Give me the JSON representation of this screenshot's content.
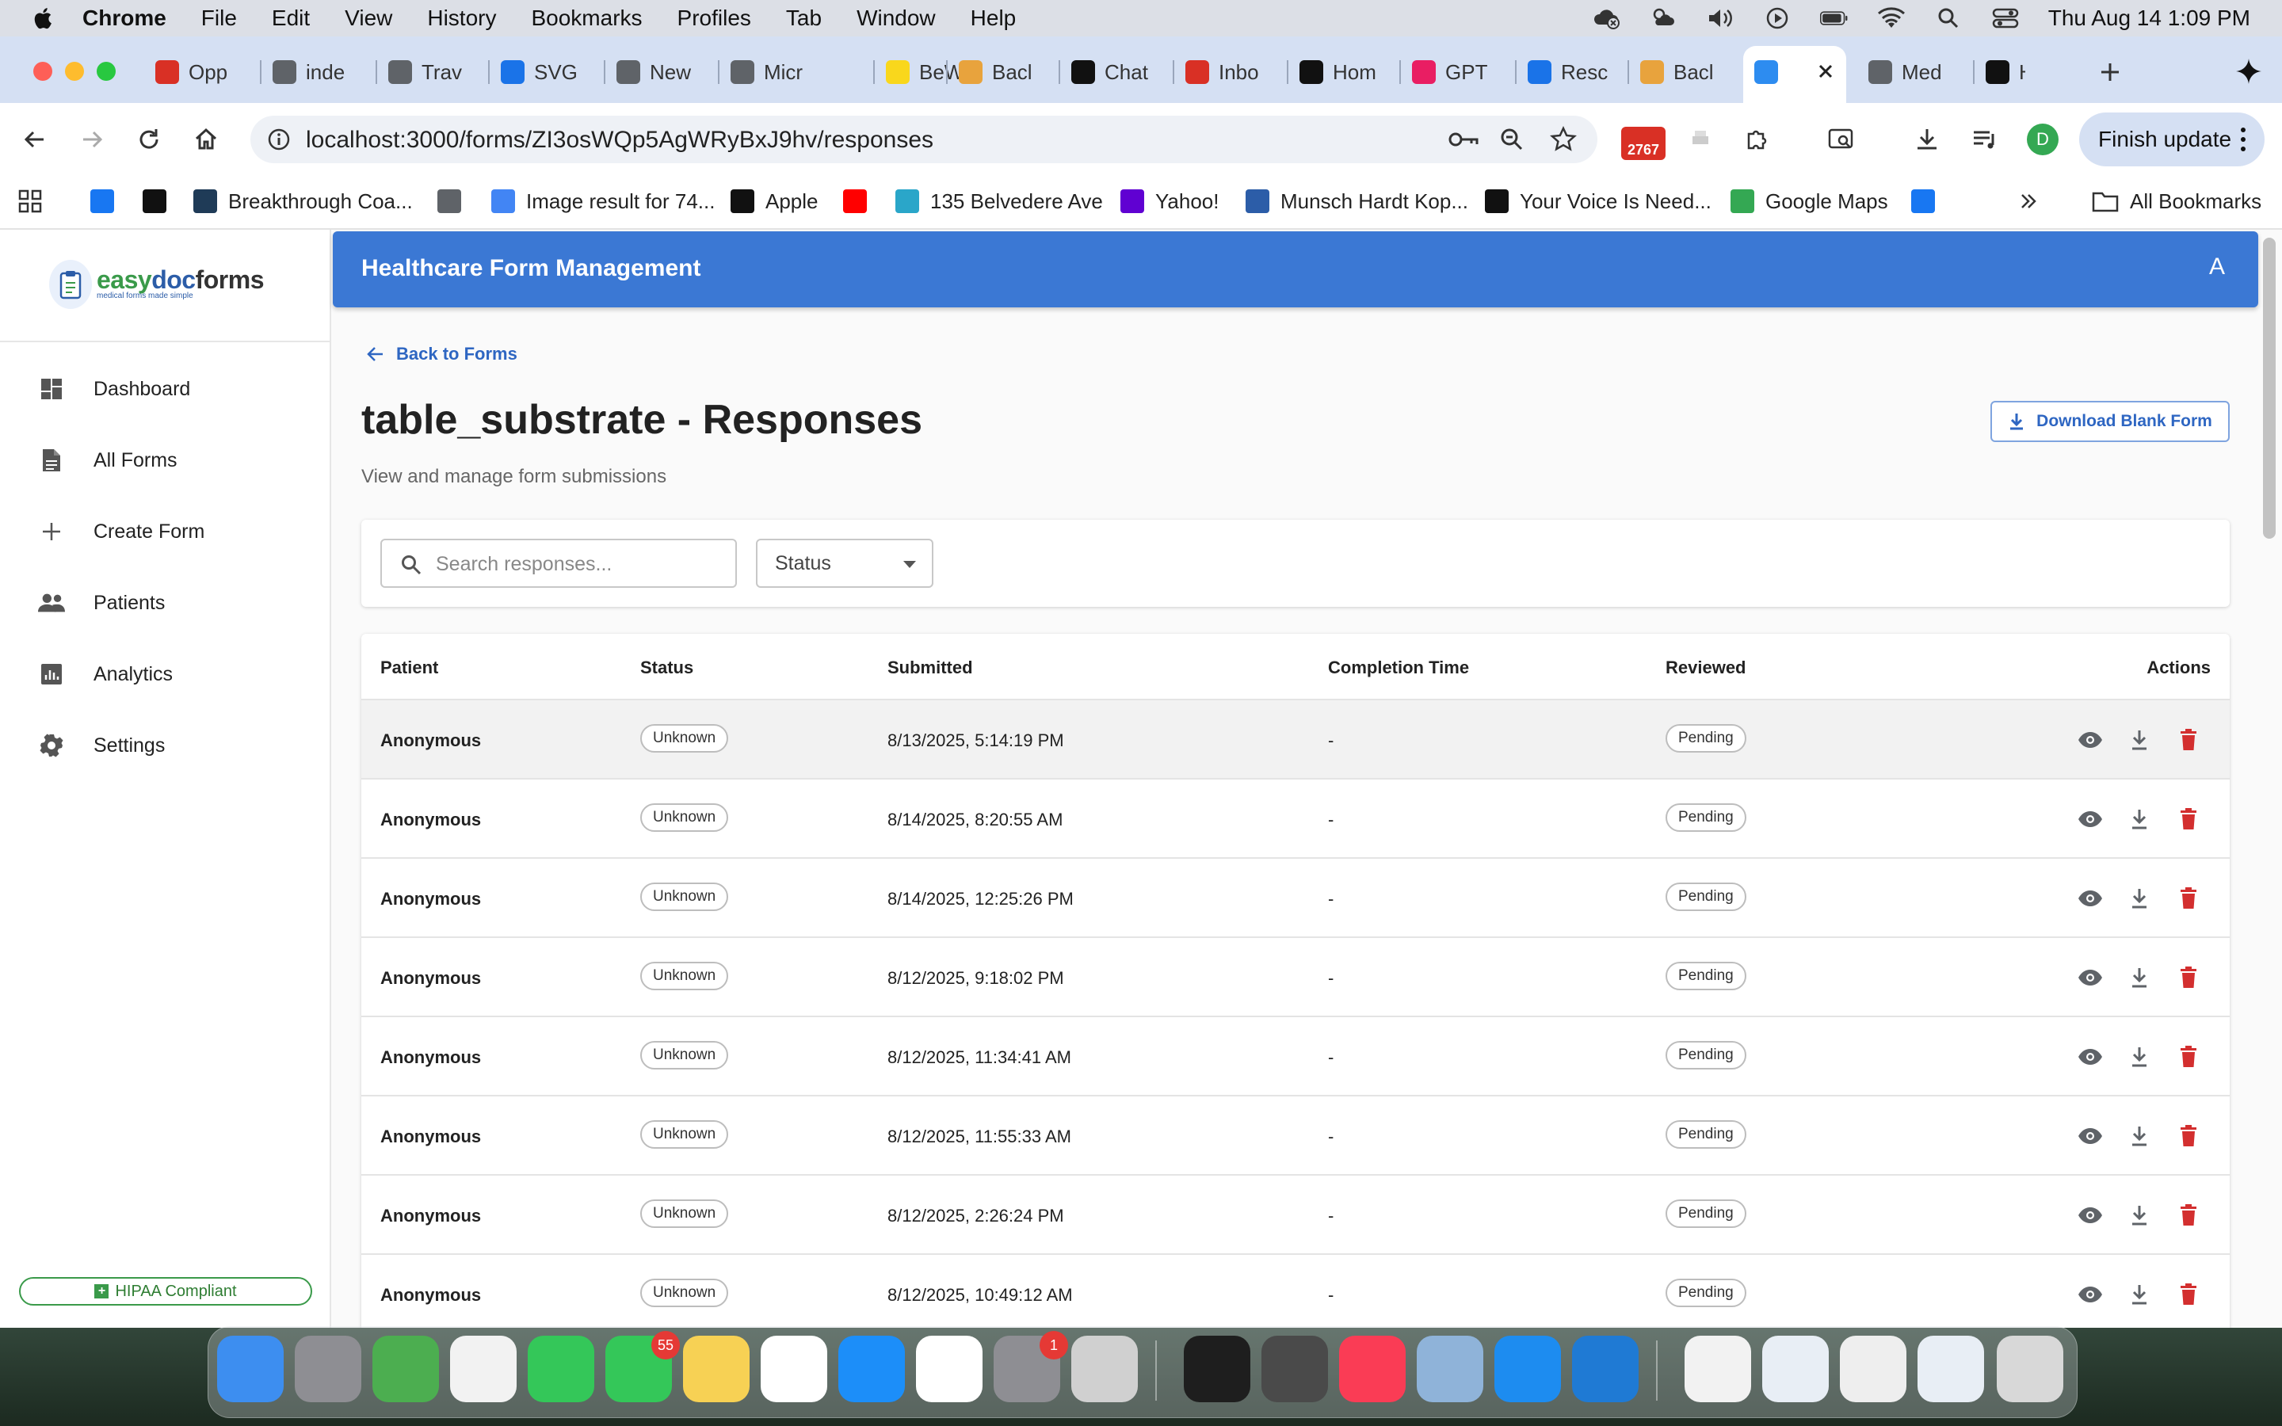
{
  "menubar": {
    "app": "Chrome",
    "items": [
      "File",
      "Edit",
      "View",
      "History",
      "Bookmarks",
      "Profiles",
      "Tab",
      "Window",
      "Help"
    ],
    "clock": "Thu Aug 14  1:09 PM"
  },
  "tabs": [
    {
      "label": "Opp",
      "icon": "opportunity-icon",
      "color": "#d93025"
    },
    {
      "label": "inde",
      "icon": "globe-icon",
      "color": "#5f6368"
    },
    {
      "label": "Trav",
      "icon": "globe-icon",
      "color": "#5f6368"
    },
    {
      "label": "SVG",
      "icon": "svg-icon",
      "color": "#1a73e8"
    },
    {
      "label": "New",
      "icon": "caduceus-icon",
      "color": "#5f6368"
    },
    {
      "label": "Micr",
      "icon": "globe-icon",
      "color": "#5f6368"
    },
    {
      "label": "BeW",
      "icon": "bew-icon",
      "color": "#f9d71c"
    },
    {
      "label": "Bacl",
      "icon": "backlog-icon",
      "color": "#e8a33d"
    },
    {
      "label": "Chat",
      "icon": "chat-icon",
      "color": "#111111"
    },
    {
      "label": "Inbo",
      "icon": "gmail-icon",
      "color": "#d93025"
    },
    {
      "label": "Hom",
      "icon": "x-icon",
      "color": "#111111"
    },
    {
      "label": "GPT",
      "icon": "rss-icon",
      "color": "#e91e63"
    },
    {
      "label": "Resc",
      "icon": "cisco-icon",
      "color": "#1a73e8"
    },
    {
      "label": "Bacl",
      "icon": "backlog-icon",
      "color": "#e8a33d"
    },
    {
      "label": "",
      "icon": "react-icon",
      "color": "#2d8cf0",
      "active": true
    },
    {
      "label": "Med",
      "icon": "globe-icon",
      "color": "#5f6368"
    },
    {
      "label": "H",
      "icon": "x-icon",
      "color": "#111111"
    }
  ],
  "omnibox": {
    "url": "localhost:3000/forms/ZI3osWQp5AgWRyBxJ9hv/responses"
  },
  "extension_badge": "2767",
  "profile_initial": "D",
  "finish_update": "Finish update",
  "bookmarks": [
    {
      "label": "",
      "icon": "facebook-icon",
      "color": "#1877f2"
    },
    {
      "label": "",
      "icon": "amazon-icon",
      "color": "#111111"
    },
    {
      "label": "Breakthrough Coa...",
      "icon": "b-icon",
      "color": "#1f3b57"
    },
    {
      "label": "",
      "icon": "globe-icon",
      "color": "#5f6368"
    },
    {
      "label": "Image result for 74...",
      "icon": "google-icon",
      "color": "#4285f4"
    },
    {
      "label": "Apple",
      "icon": "apple-icon",
      "color": "#111111"
    },
    {
      "label": "",
      "icon": "youtube-icon",
      "color": "#ff0000"
    },
    {
      "label": "135 Belvedere Ave",
      "icon": "house-icon",
      "color": "#2aa6c9"
    },
    {
      "label": "Yahoo!",
      "icon": "yahoo-icon",
      "color": "#6001d2"
    },
    {
      "label": "Munsch Hardt Kop...",
      "icon": "m-icon",
      "color": "#2c5da8"
    },
    {
      "label": "Your Voice Is Need...",
      "icon": "m-icon",
      "color": "#111111"
    },
    {
      "label": "Google Maps",
      "icon": "maps-pin-icon",
      "color": "#34a853"
    },
    {
      "label": "",
      "icon": "facebook-icon",
      "color": "#1877f2"
    }
  ],
  "all_bookmarks": "All Bookmarks",
  "sidebar": {
    "logo": {
      "easy": "easy",
      "doc": "doc",
      "forms": "forms",
      "tagline": "medical forms made simple"
    },
    "items": [
      {
        "label": "Dashboard",
        "icon": "dashboard-icon"
      },
      {
        "label": "All Forms",
        "icon": "document-icon"
      },
      {
        "label": "Create Form",
        "icon": "plus-icon"
      },
      {
        "label": "Patients",
        "icon": "people-icon"
      },
      {
        "label": "Analytics",
        "icon": "analytics-icon"
      },
      {
        "label": "Settings",
        "icon": "gear-icon"
      }
    ],
    "hipaa": "HIPAA Compliant"
  },
  "appbar": {
    "title": "Healthcare Form Management",
    "avatar": "A"
  },
  "main": {
    "back": "Back to Forms",
    "title": "table_substrate - Responses",
    "subtitle": "View and manage form submissions",
    "download_blank": "Download Blank Form",
    "search_placeholder": "Search responses...",
    "status_filter": "Status"
  },
  "table": {
    "headers": [
      "Patient",
      "Status",
      "Submitted",
      "Completion Time",
      "Reviewed",
      "Actions"
    ],
    "rows": [
      {
        "patient": "Anonymous",
        "status": "Unknown",
        "submitted": "8/13/2025, 5:14:19 PM",
        "completion": "-",
        "reviewed": "Pending"
      },
      {
        "patient": "Anonymous",
        "status": "Unknown",
        "submitted": "8/14/2025, 8:20:55 AM",
        "completion": "-",
        "reviewed": "Pending"
      },
      {
        "patient": "Anonymous",
        "status": "Unknown",
        "submitted": "8/14/2025, 12:25:26 PM",
        "completion": "-",
        "reviewed": "Pending"
      },
      {
        "patient": "Anonymous",
        "status": "Unknown",
        "submitted": "8/12/2025, 9:18:02 PM",
        "completion": "-",
        "reviewed": "Pending"
      },
      {
        "patient": "Anonymous",
        "status": "Unknown",
        "submitted": "8/12/2025, 11:34:41 AM",
        "completion": "-",
        "reviewed": "Pending"
      },
      {
        "patient": "Anonymous",
        "status": "Unknown",
        "submitted": "8/12/2025, 11:55:33 AM",
        "completion": "-",
        "reviewed": "Pending"
      },
      {
        "patient": "Anonymous",
        "status": "Unknown",
        "submitted": "8/12/2025, 2:26:24 PM",
        "completion": "-",
        "reviewed": "Pending"
      },
      {
        "patient": "Anonymous",
        "status": "Unknown",
        "submitted": "8/12/2025, 10:49:12 AM",
        "completion": "-",
        "reviewed": "Pending"
      }
    ]
  },
  "dock": {
    "apps": [
      {
        "name": "finder-icon",
        "color": "#3d8ef0"
      },
      {
        "name": "launchpad-icon",
        "color": "#8e8e93"
      },
      {
        "name": "maps-icon",
        "color": "#4cae50"
      },
      {
        "name": "photos-icon",
        "color": "#f2f2f2"
      },
      {
        "name": "facetime-icon",
        "color": "#34c759"
      },
      {
        "name": "messages-icon",
        "color": "#34c759",
        "badge": "55"
      },
      {
        "name": "notes-icon",
        "color": "#f7d154"
      },
      {
        "name": "reminders-icon",
        "color": "#ffffff"
      },
      {
        "name": "app-store-icon",
        "color": "#1c8ef9"
      },
      {
        "name": "chrome-icon",
        "color": "#ffffff"
      },
      {
        "name": "system-settings-icon",
        "color": "#8e8e93",
        "badge": "1"
      },
      {
        "name": "iphone-mirroring-icon",
        "color": "#d0d0d0"
      },
      {
        "name": "terminal-icon",
        "color": "#1e1e1e"
      },
      {
        "name": "color-picker-icon",
        "color": "#4a4a4a"
      },
      {
        "name": "music-icon",
        "color": "#fa3c55"
      },
      {
        "name": "preview-icon",
        "color": "#8fb3d9"
      },
      {
        "name": "docker-icon",
        "color": "#1d8cf0"
      },
      {
        "name": "vscode-icon",
        "color": "#1f7ad4"
      },
      {
        "name": "pdf-document-icon",
        "color": "#f2f2f2"
      },
      {
        "name": "screenshot-thumbnail-icon",
        "color": "#e8eef5"
      },
      {
        "name": "spreadsheet-thumbnail-icon",
        "color": "#eeeeee"
      },
      {
        "name": "window-thumbnail-icon",
        "color": "#e8eef5"
      },
      {
        "name": "trash-icon",
        "color": "#d8d8d8"
      }
    ]
  },
  "colors": {
    "primary": "#3b78d4",
    "link": "#2e66c2",
    "danger": "#d32f2f",
    "success": "#3a9a4a"
  }
}
